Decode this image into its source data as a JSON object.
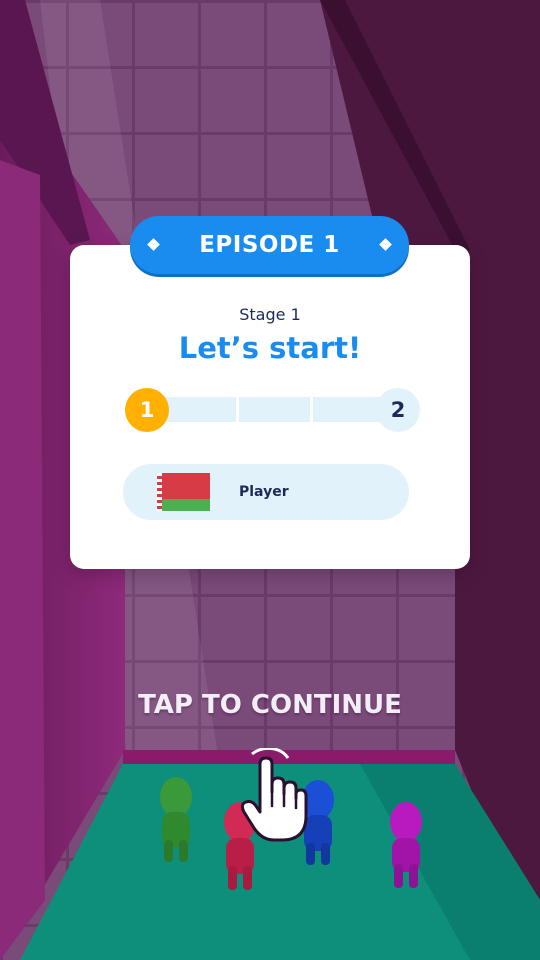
{
  "episode": {
    "title": "EPISODE 1"
  },
  "stage": {
    "label": "Stage 1",
    "headline": "Let’s start!"
  },
  "progress": {
    "current_stage": "1",
    "next_stage": "2",
    "segments": 3,
    "filled_segments": 0
  },
  "player": {
    "name": "Player",
    "flag": "belarus-flag-icon"
  },
  "prompt": {
    "tap_label": "TAP TO CONTINUE"
  },
  "colors": {
    "accent": "#1a8cf0",
    "stage_node": "#ffb000",
    "track": "#e1f2fb",
    "floor": "#0d8f7c",
    "wall": "#7a2166"
  }
}
